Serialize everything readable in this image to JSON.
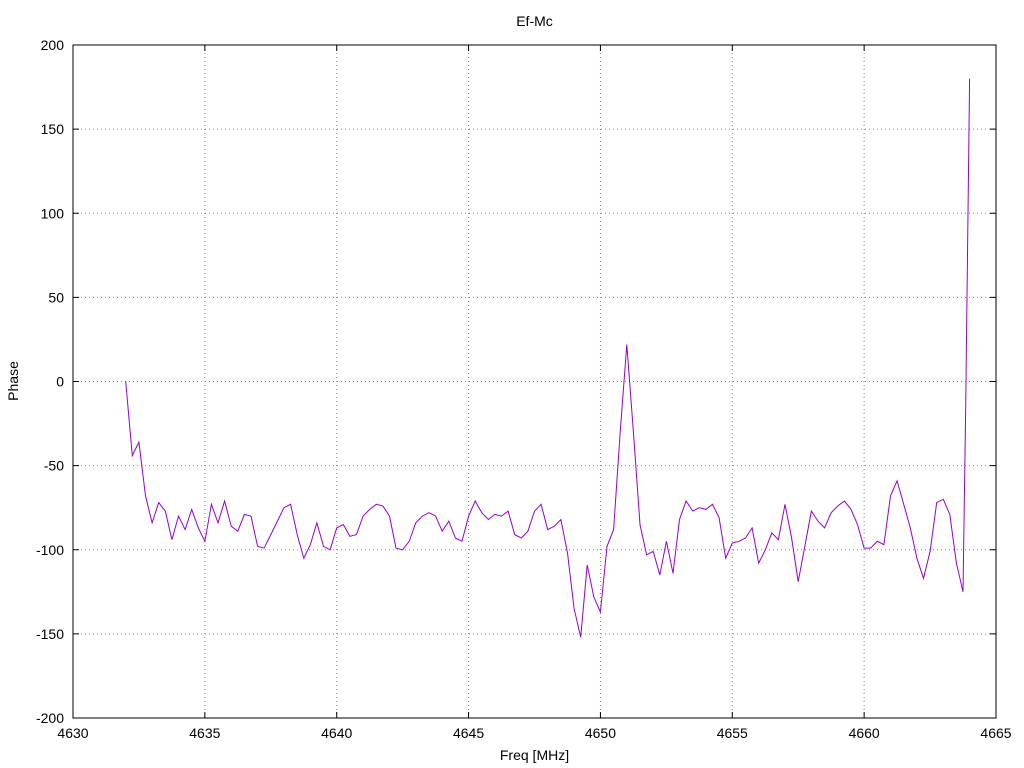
{
  "chart_data": {
    "type": "line",
    "title": "Ef-Mc",
    "xlabel": "Freq [MHz]",
    "ylabel": "Phase",
    "xlim": [
      4630,
      4665
    ],
    "ylim": [
      -200,
      200
    ],
    "grid": true,
    "xticks": [
      4630,
      4635,
      4640,
      4645,
      4650,
      4655,
      4660,
      4665
    ],
    "yticks": [
      -200,
      -150,
      -100,
      -50,
      0,
      50,
      100,
      150,
      200
    ],
    "line_color": "#9400d3",
    "series": [
      {
        "x": [
          4632.0,
          4632.25,
          4632.5,
          4632.75,
          4633.0,
          4633.25,
          4633.5,
          4633.75,
          4634.0,
          4634.25,
          4634.5,
          4634.75,
          4635.0,
          4635.25,
          4635.5,
          4635.75,
          4636.0,
          4636.25,
          4636.5,
          4636.75,
          4637.0,
          4637.25,
          4637.5,
          4637.75,
          4638.0,
          4638.25,
          4638.5,
          4638.75,
          4639.0,
          4639.25,
          4639.5,
          4639.75,
          4640.0,
          4640.25,
          4640.5,
          4640.75,
          4641.0,
          4641.25,
          4641.5,
          4641.75,
          4642.0,
          4642.25,
          4642.5,
          4642.75,
          4643.0,
          4643.25,
          4643.5,
          4643.75,
          4644.0,
          4644.25,
          4644.5,
          4644.75,
          4645.0,
          4645.25,
          4645.5,
          4645.75,
          4646.0,
          4646.25,
          4646.5,
          4646.75,
          4647.0,
          4647.25,
          4647.5,
          4647.75,
          4648.0,
          4648.25,
          4648.5,
          4648.75,
          4649.0,
          4649.25,
          4649.5,
          4649.75,
          4650.0,
          4650.25,
          4650.5,
          4650.75,
          4651.0,
          4651.25,
          4651.5,
          4651.75,
          4652.0,
          4652.25,
          4652.5,
          4652.75,
          4653.0,
          4653.25,
          4653.5,
          4653.75,
          4654.0,
          4654.25,
          4654.5,
          4654.75,
          4655.0,
          4655.25,
          4655.5,
          4655.75,
          4656.0,
          4656.25,
          4656.5,
          4656.75,
          4657.0,
          4657.25,
          4657.5,
          4657.75,
          4658.0,
          4658.25,
          4658.5,
          4658.75,
          4659.0,
          4659.25,
          4659.5,
          4659.75,
          4660.0,
          4660.25,
          4660.5,
          4660.75,
          4661.0,
          4661.25,
          4661.5,
          4661.75,
          4662.0,
          4662.25,
          4662.5,
          4662.75,
          4663.0,
          4663.25,
          4663.5,
          4663.75,
          4663.85,
          4664.0
        ],
        "y": [
          0,
          -44,
          -36,
          -68,
          -84,
          -72,
          -77,
          -94,
          -80,
          -88,
          -76,
          -87,
          -95,
          -73,
          -84,
          -71,
          -86,
          -89,
          -79,
          -80,
          -98,
          -99,
          -91,
          -83,
          -75,
          -73,
          -91,
          -105,
          -97,
          -84,
          -98,
          -100,
          -87,
          -85,
          -92,
          -91,
          -80,
          -76,
          -73,
          -74,
          -80,
          -99,
          -100,
          -95,
          -84,
          -80,
          -78,
          -80,
          -89,
          -83,
          -93,
          -95,
          -80,
          -71,
          -78,
          -82,
          -79,
          -80,
          -77,
          -91,
          -93,
          -89,
          -77,
          -73,
          -88,
          -86,
          -82,
          -102,
          -135,
          -152,
          -109,
          -128,
          -137,
          -98,
          -88,
          -30,
          22,
          -30,
          -85,
          -103,
          -101,
          -115,
          -95,
          -114,
          -82,
          -71,
          -77,
          -75,
          -76,
          -73,
          -81,
          -105,
          -96,
          -95,
          -93,
          -87,
          -108,
          -100,
          -90,
          -94,
          -73,
          -93,
          -119,
          -98,
          -77,
          -83,
          -87,
          -78,
          -74,
          -71,
          -76,
          -85,
          -99,
          -99,
          -95,
          -97,
          -68,
          -59,
          -73,
          -87,
          -105,
          -117,
          -101,
          -72,
          -70,
          -79,
          -108,
          -125,
          -15,
          180
        ]
      }
    ]
  }
}
